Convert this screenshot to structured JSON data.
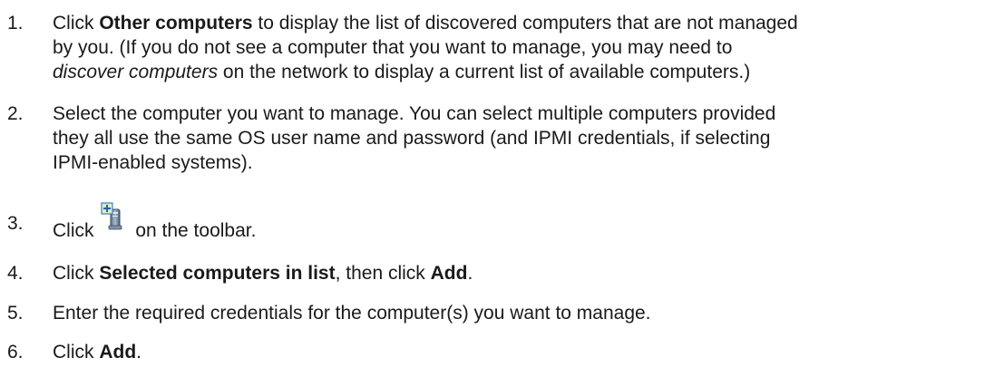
{
  "steps": [
    {
      "number": "1.",
      "line1_a": "Click ",
      "line1_b": "Other computers",
      "line1_c": " to display the list of discovered computers that are not managed",
      "line2": "by you. (If you do not see a computer that you want to manage, you may need to",
      "line3_a": "discover computers",
      "line3_b": " on the network to display a current list of available computers.)"
    },
    {
      "number": "2.",
      "line1": "Select the computer you want to manage. You can select multiple computers provided",
      "line2": "they all use the same OS user name and password (and IPMI credentials, if selecting",
      "line3": "IPMI-enabled systems)."
    },
    {
      "number": "3.",
      "text_a": "Click",
      "icon": "add-computer-icon",
      "text_b": " on the toolbar."
    },
    {
      "number": "4.",
      "text_a": "Click ",
      "text_b": "Selected computers in list",
      "text_c": ", then click ",
      "text_d": "Add",
      "text_e": "."
    },
    {
      "number": "5.",
      "text": "Enter the required credentials for the computer(s) you want to manage."
    },
    {
      "number": "6.",
      "text_a": "Click ",
      "text_b": "Add",
      "text_c": "."
    }
  ]
}
